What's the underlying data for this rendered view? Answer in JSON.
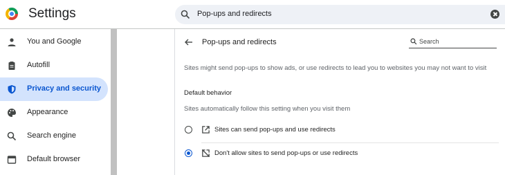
{
  "header": {
    "title": "Settings",
    "search_value": "Pop-ups and redirects"
  },
  "sidebar": {
    "items": [
      {
        "label": "You and Google",
        "icon": "person-icon"
      },
      {
        "label": "Autofill",
        "icon": "clipboard-icon"
      },
      {
        "label": "Privacy and security",
        "icon": "shield-icon",
        "active": true
      },
      {
        "label": "Appearance",
        "icon": "palette-icon"
      },
      {
        "label": "Search engine",
        "icon": "search-icon"
      },
      {
        "label": "Default browser",
        "icon": "browser-window-icon"
      }
    ]
  },
  "page": {
    "title": "Pop-ups and redirects",
    "search_placeholder": "Search",
    "description": "Sites might send pop-ups to show ads, or use redirects to lead you to websites you may not want to visit",
    "section_title": "Default behavior",
    "section_subtitle": "Sites automatically follow this setting when you visit them",
    "options": [
      {
        "label": "Sites can send pop-ups and use redirects",
        "icon": "open-in-new-icon",
        "selected": false
      },
      {
        "label": "Don't allow sites to send pop-ups or use redirects",
        "icon": "block-popup-icon",
        "selected": true
      }
    ]
  },
  "colors": {
    "accent": "#0b57d0",
    "active_nav_bg": "#d3e3fd",
    "search_bg": "#eef1f6"
  }
}
